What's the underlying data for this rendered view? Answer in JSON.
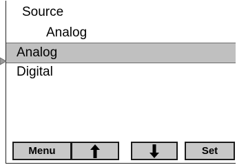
{
  "header": {
    "title": "Source",
    "current_value": "Analog"
  },
  "menu": {
    "items": [
      {
        "label": "Analog",
        "selected": true
      },
      {
        "label": "Digital",
        "selected": false
      }
    ],
    "pointer_icon": "triangle-pointer-icon"
  },
  "softkeys": {
    "menu_label": "Menu",
    "up_icon": "arrow-up-icon",
    "down_icon": "arrow-down-icon",
    "set_label": "Set"
  },
  "colors": {
    "selection_bg": "#c0c0c0",
    "button_bg": "#c8c8c8",
    "border": "#1a1a1a"
  }
}
